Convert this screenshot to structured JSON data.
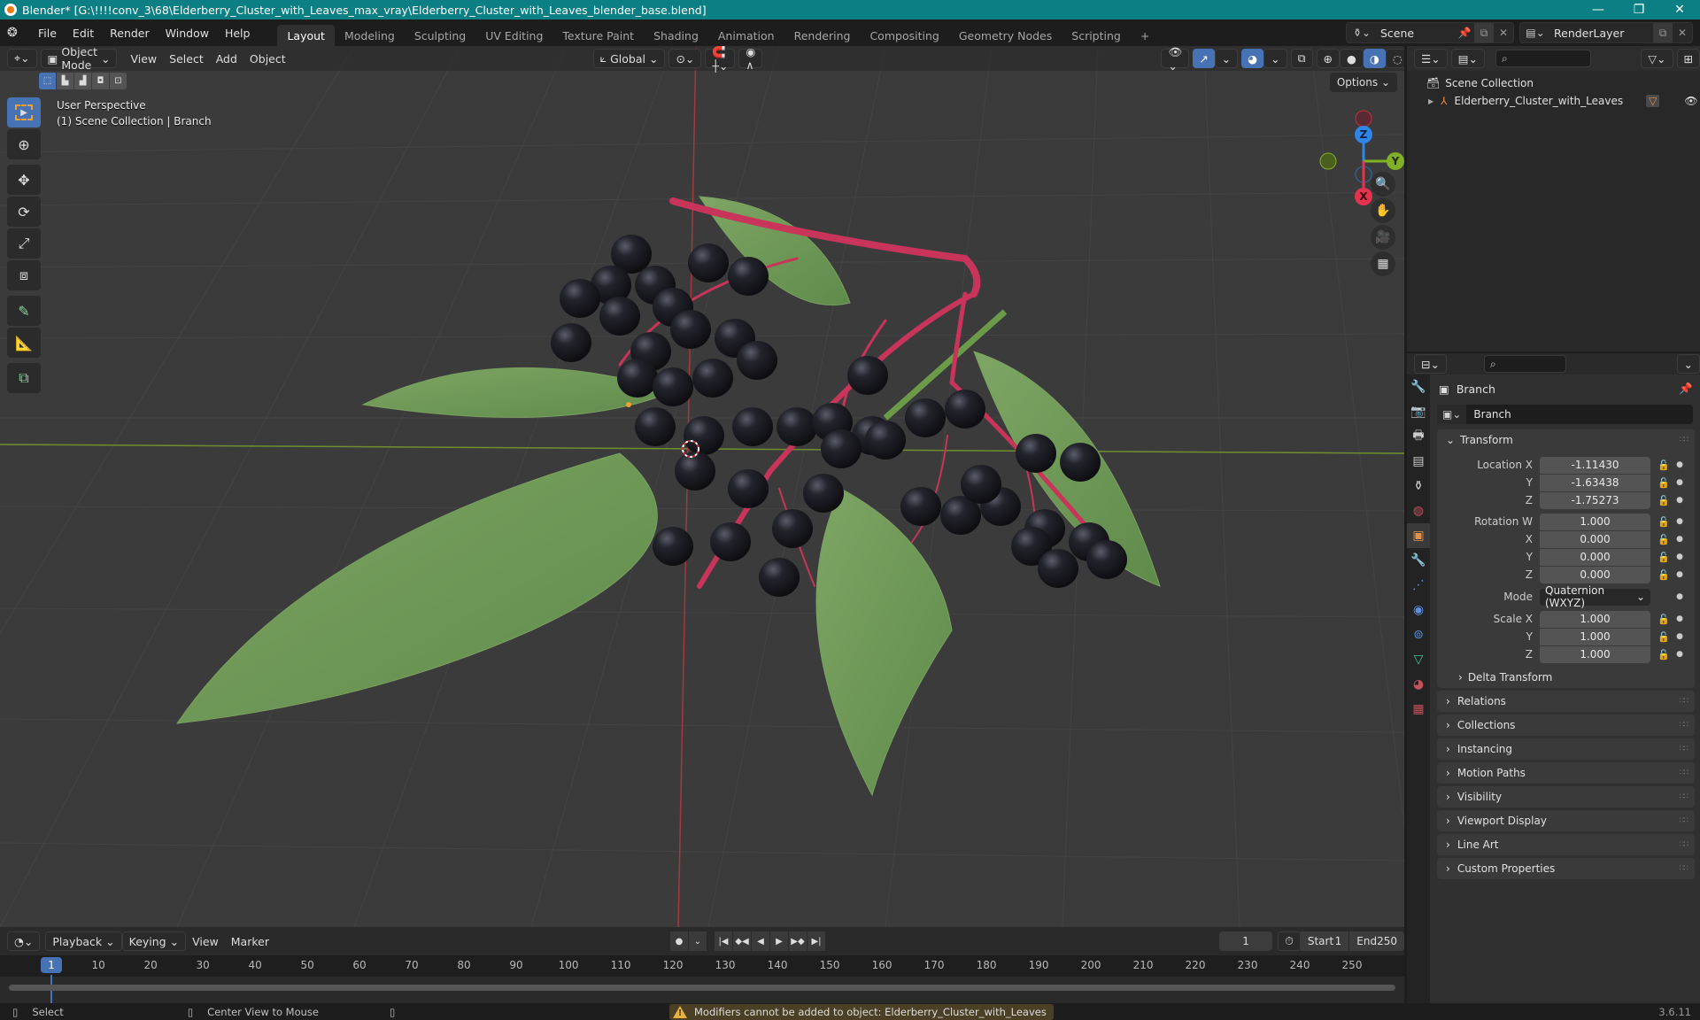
{
  "window": {
    "title": "Blender* [G:\\!!!!conv_3\\68\\Elderberry_Cluster_with_Leaves_max_vray\\Elderberry_Cluster_with_Leaves_blender_base.blend]",
    "controls": {
      "minimize": "—",
      "maximize": "❐",
      "close": "✕"
    }
  },
  "menu": {
    "items": [
      "File",
      "Edit",
      "Render",
      "Window",
      "Help"
    ]
  },
  "workspaces": {
    "tabs": [
      "Layout",
      "Modeling",
      "Sculpting",
      "UV Editing",
      "Texture Paint",
      "Shading",
      "Animation",
      "Rendering",
      "Compositing",
      "Geometry Nodes",
      "Scripting"
    ],
    "active": "Layout",
    "add_label": "+"
  },
  "scene": {
    "name": "Scene",
    "render_layer": "RenderLayer"
  },
  "viewport": {
    "mode": "Object Mode",
    "menus": [
      "View",
      "Select",
      "Add",
      "Object"
    ],
    "orientation": "Global",
    "options_label": "Options",
    "perspective_label": "User Perspective",
    "collection_label": "(1) Scene Collection | Branch",
    "gizmo_axes": {
      "x": "X",
      "y": "Y",
      "z": "Z"
    },
    "colors": {
      "x_axis": "#e2344e",
      "y_axis": "#80b026",
      "z_axis": "#2f86e8",
      "accent": "#4772b3",
      "leaf": "#6f9a55",
      "berry": "#1f2028",
      "stem": "#c8345a"
    },
    "tools": [
      "select-box",
      "cursor",
      "move",
      "rotate",
      "scale",
      "transform",
      "annotate",
      "measure",
      "add-cube"
    ]
  },
  "outliner": {
    "root": "Scene Collection",
    "items": [
      {
        "name": "Elderberry_Cluster_with_Leaves"
      }
    ]
  },
  "properties": {
    "object_name": "Branch",
    "name_field": "Branch",
    "transform": {
      "title": "Transform",
      "location": {
        "label": "Location X",
        "x": "-1.11430",
        "y": "-1.63438",
        "z": "-1.75273"
      },
      "rotation": {
        "label": "Rotation W",
        "w": "1.000",
        "x": "0.000",
        "y": "0.000",
        "z": "0.000"
      },
      "mode_label": "Mode",
      "mode_value": "Quaternion (WXYZ)",
      "scale": {
        "label": "Scale X",
        "x": "1.000",
        "y": "1.000",
        "z": "1.000"
      },
      "axis_labels": {
        "x": "X",
        "y": "Y",
        "z": "Z"
      },
      "delta": "Delta Transform"
    },
    "panels": [
      "Relations",
      "Collections",
      "Instancing",
      "Motion Paths",
      "Visibility",
      "Viewport Display",
      "Line Art",
      "Custom Properties"
    ]
  },
  "timeline": {
    "menus": [
      "Playback",
      "Keying",
      "View",
      "Marker"
    ],
    "current_frame": "1",
    "start_label": "Start",
    "start": "1",
    "end_label": "End",
    "end": "250",
    "ticks": [
      "10",
      "20",
      "30",
      "40",
      "50",
      "60",
      "70",
      "80",
      "90",
      "100",
      "110",
      "120",
      "130",
      "140",
      "150",
      "160",
      "170",
      "180",
      "190",
      "200",
      "210",
      "220",
      "230",
      "240",
      "250"
    ]
  },
  "statusbar": {
    "select": "Select",
    "center_view": "Center View to Mouse",
    "warning": "Modifiers cannot be added to object: Elderberry_Cluster_with_Leaves",
    "version": "3.6.11"
  }
}
